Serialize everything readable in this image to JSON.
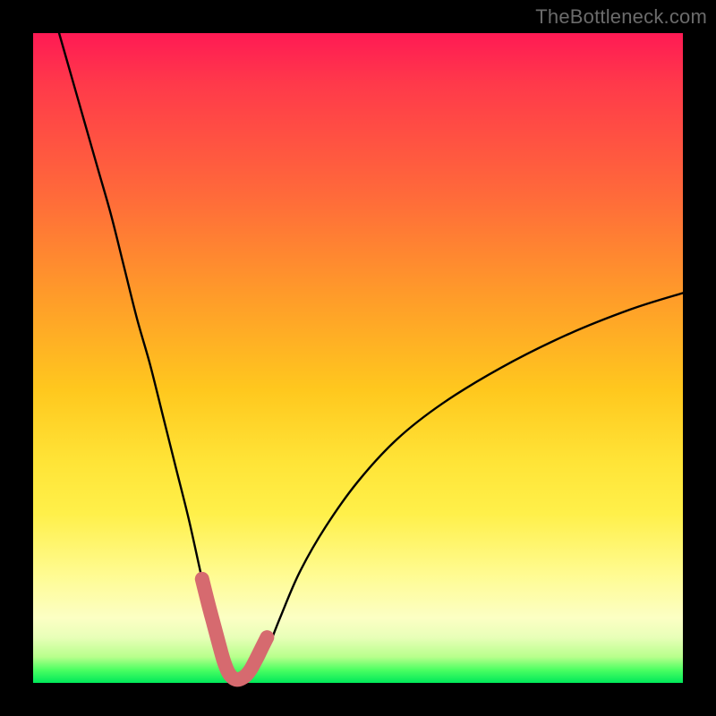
{
  "watermark": "TheBottleneck.com",
  "chart_data": {
    "type": "line",
    "title": "",
    "xlabel": "",
    "ylabel": "",
    "xlim": [
      0,
      100
    ],
    "ylim": [
      0,
      100
    ],
    "series": [
      {
        "name": "curve",
        "x": [
          4,
          6,
          8,
          10,
          12,
          14,
          16,
          18,
          20,
          22,
          24,
          26,
          27.5,
          29,
          30,
          31,
          32,
          33,
          34.5,
          36,
          38,
          41,
          45,
          50,
          56,
          63,
          72,
          82,
          92,
          100
        ],
        "values": [
          100,
          93,
          86,
          79,
          72,
          64,
          56,
          49,
          41,
          33,
          25,
          16,
          10,
          4.5,
          1.5,
          0.6,
          0.5,
          0.9,
          2.2,
          5,
          10,
          17,
          24,
          31,
          37.5,
          43,
          48.5,
          53.5,
          57.5,
          60
        ]
      },
      {
        "name": "highlight",
        "x": [
          26,
          27,
          27.8,
          28.6,
          29.3,
          30,
          30.7,
          31.4,
          32.1,
          32.8,
          33.5,
          34.2,
          35,
          36
        ],
        "values": [
          16,
          12,
          9,
          6,
          3.5,
          1.7,
          0.8,
          0.5,
          0.7,
          1.2,
          2.1,
          3.4,
          5,
          7
        ]
      }
    ],
    "colors": {
      "curve": "#000000",
      "highlight": "#d66a6f",
      "gradient_top": "#ff1a54",
      "gradient_bottom": "#00e85a"
    }
  }
}
